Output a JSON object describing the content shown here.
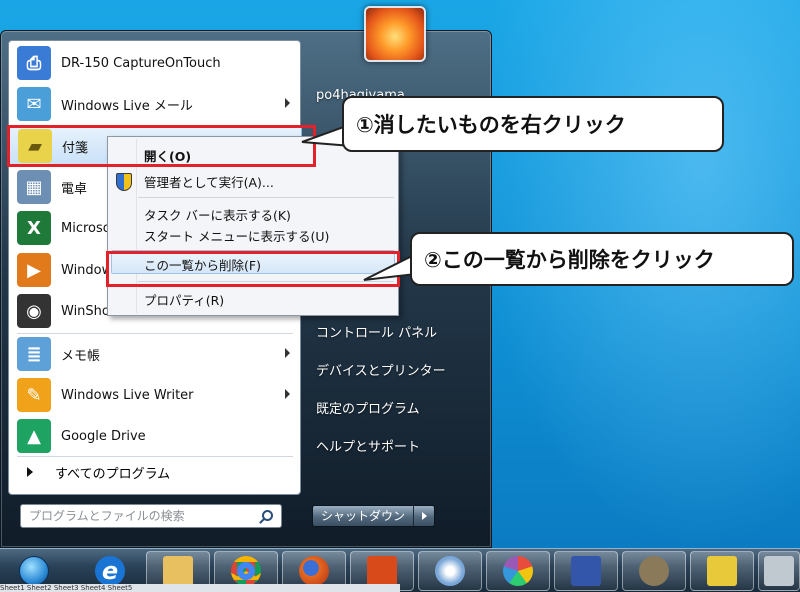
{
  "left_menu": {
    "items": [
      {
        "label": "DR-150 CaptureOnTouch",
        "icon": "scanner-icon",
        "color": "#3a7bd5",
        "arrow": false
      },
      {
        "label": "Windows Live メール",
        "icon": "mail-icon",
        "color": "#4a9fd9",
        "arrow": true
      },
      {
        "label": "付箋",
        "icon": "sticky-note-icon",
        "color": "#e8d34a",
        "arrow": true
      },
      {
        "label": "電卓",
        "icon": "calculator-icon",
        "color": "#6d8fb3",
        "arrow": false
      },
      {
        "label": "Microsof",
        "icon": "excel-icon",
        "color": "#1f7a3a",
        "arrow": false
      },
      {
        "label": "Windows",
        "icon": "media-player-icon",
        "color": "#e07a1a",
        "arrow": false
      },
      {
        "label": "WinShot",
        "icon": "winshot-icon",
        "color": "#333333",
        "arrow": false
      },
      {
        "label": "メモ帳",
        "icon": "notepad-icon",
        "color": "#5ea0d8",
        "arrow": true
      },
      {
        "label": "Windows Live Writer",
        "icon": "writer-icon",
        "color": "#f0a31a",
        "arrow": true
      },
      {
        "label": "Google Drive",
        "icon": "google-drive-icon",
        "color": "#1ea362",
        "arrow": false
      }
    ],
    "all_programs": "すべてのプログラム",
    "search_placeholder": "プログラムとファイルの検索"
  },
  "right_menu": {
    "user": "po4hagiyama",
    "items": [
      "コントロール パネル",
      "デバイスとプリンター",
      "既定のプログラム",
      "ヘルプとサポート"
    ],
    "shutdown": "シャットダウン"
  },
  "context_menu": {
    "open": "開く(O)",
    "run_as_admin": "管理者として実行(A)...",
    "pin_taskbar": "タスク バーに表示する(K)",
    "pin_start": "スタート メニューに表示する(U)",
    "remove": "この一覧から削除(F)",
    "properties": "プロパティ(R)"
  },
  "callouts": {
    "step1": "①消したいものを右クリック",
    "step2": "②この一覧から削除をクリック"
  },
  "taskbar": {
    "apps": [
      {
        "name": "start-orb-icon",
        "color": "#2c8bd6"
      },
      {
        "name": "internet-explorer-icon",
        "color": "#1a74d4"
      },
      {
        "name": "explorer-icon",
        "color": "#e8c060"
      },
      {
        "name": "chrome-icon",
        "color": "#db4437"
      },
      {
        "name": "firefox-icon",
        "color": "#e66a1e"
      },
      {
        "name": "office-icon",
        "color": "#d94a1a"
      },
      {
        "name": "paint-icon",
        "color": "#7aa7d8"
      },
      {
        "name": "picasa-icon",
        "color": "#9b59b6"
      },
      {
        "name": "app-icon",
        "color": "#3355aa"
      },
      {
        "name": "gimp-icon",
        "color": "#8a7a5a"
      },
      {
        "name": "sticky-icon",
        "color": "#e8c93a"
      },
      {
        "name": "window-icon",
        "color": "#c0c8d0"
      }
    ],
    "sheets": "Sheet1  Sheet2  Sheet3  Sheet4  Sheet5"
  },
  "colors": {
    "highlight_red": "#e2212a",
    "desktop_blue": "#1aa6e6"
  }
}
